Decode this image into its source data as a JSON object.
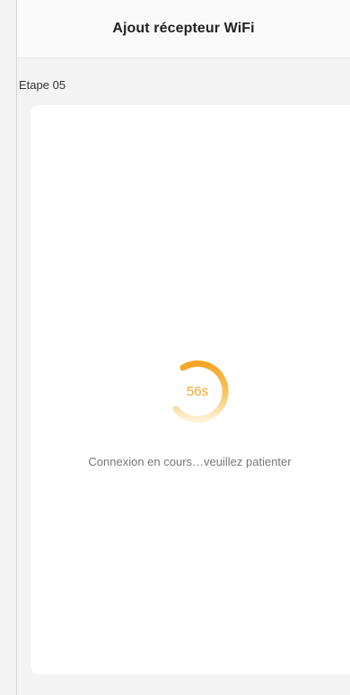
{
  "header": {
    "title": "Ajout récepteur WiFi"
  },
  "step": {
    "label": "Etape 05"
  },
  "progress": {
    "countdown": "56s",
    "status": "Connexion en cours…veuillez patienter"
  },
  "colors": {
    "accent": "#f5a524",
    "accent_light": "#fde9bf",
    "background": "#f4f4f4",
    "card": "#ffffff"
  },
  "icons": {
    "spinner": "loading-ring-icon"
  }
}
